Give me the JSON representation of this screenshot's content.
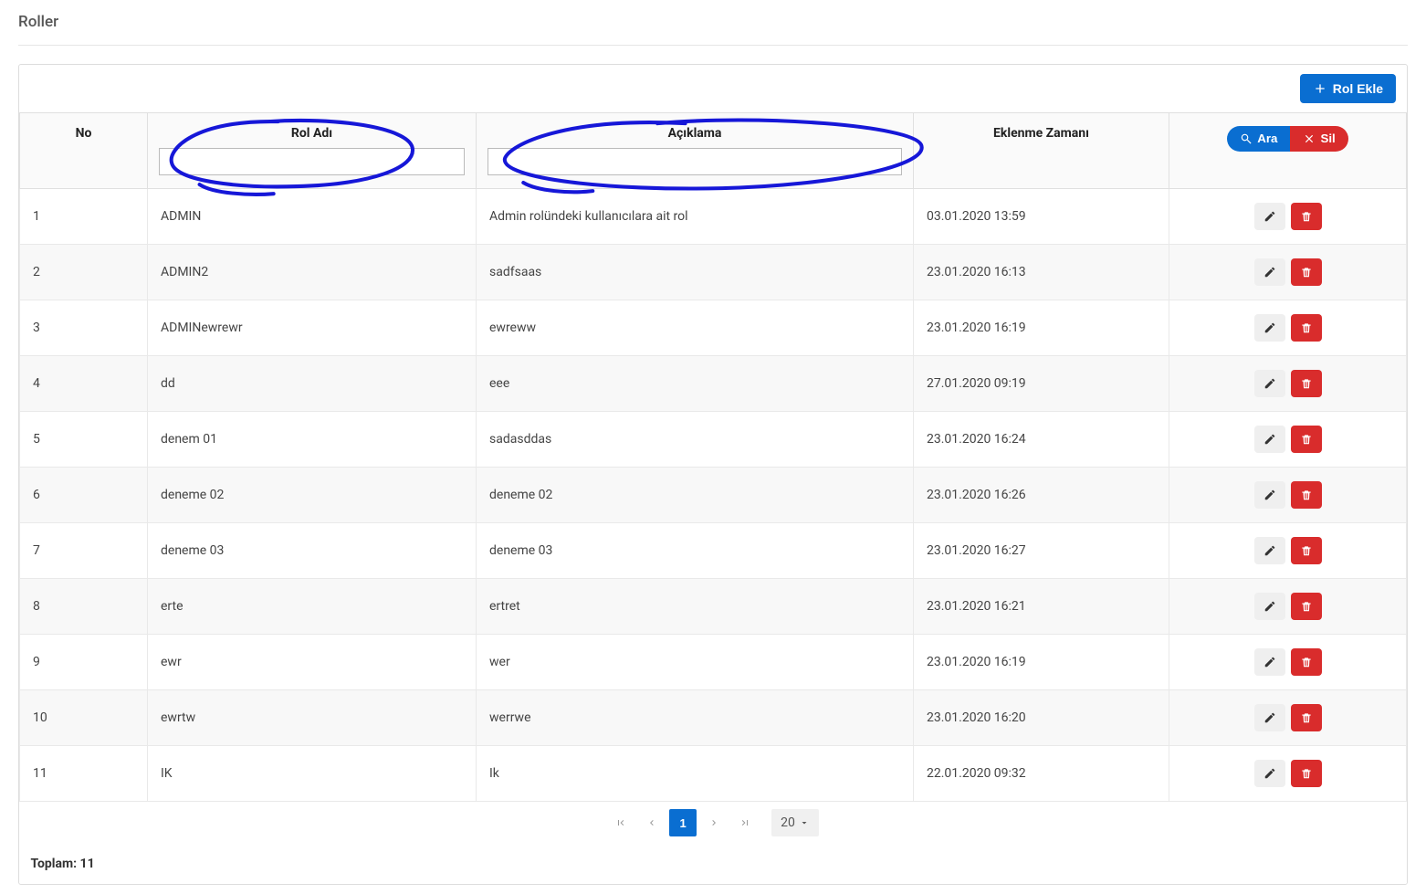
{
  "page": {
    "title": "Roller"
  },
  "toolbar": {
    "add_label": "Rol Ekle"
  },
  "columns": {
    "no": "No",
    "name": "Rol Adı",
    "desc": "Açıklama",
    "date": "Eklenme Zamanı"
  },
  "filter": {
    "search_label": "Ara",
    "clear_label": "Sil",
    "name_value": "",
    "desc_value": ""
  },
  "rows": [
    {
      "no": "1",
      "name": "ADMIN",
      "desc": "Admin rolündeki kullanıcılara ait rol",
      "date": "03.01.2020 13:59"
    },
    {
      "no": "2",
      "name": "ADMIN2",
      "desc": "sadfsaas",
      "date": "23.01.2020 16:13"
    },
    {
      "no": "3",
      "name": "ADMINewrewr",
      "desc": "ewreww",
      "date": "23.01.2020 16:19"
    },
    {
      "no": "4",
      "name": "dd",
      "desc": "eee",
      "date": "27.01.2020 09:19"
    },
    {
      "no": "5",
      "name": "denem 01",
      "desc": "sadasddas",
      "date": "23.01.2020 16:24"
    },
    {
      "no": "6",
      "name": "deneme 02",
      "desc": "deneme 02",
      "date": "23.01.2020 16:26"
    },
    {
      "no": "7",
      "name": "deneme 03",
      "desc": "deneme 03",
      "date": "23.01.2020 16:27"
    },
    {
      "no": "8",
      "name": "erte",
      "desc": "ertret",
      "date": "23.01.2020 16:21"
    },
    {
      "no": "9",
      "name": "ewr",
      "desc": "wer",
      "date": "23.01.2020 16:19"
    },
    {
      "no": "10",
      "name": "ewrtw",
      "desc": "werrwe",
      "date": "23.01.2020 16:20"
    },
    {
      "no": "11",
      "name": "IK",
      "desc": "Ik",
      "date": "22.01.2020 09:32"
    }
  ],
  "pager": {
    "current": "1",
    "page_size": "20"
  },
  "footer": {
    "total_label": "Toplam:",
    "total_value": "11"
  }
}
